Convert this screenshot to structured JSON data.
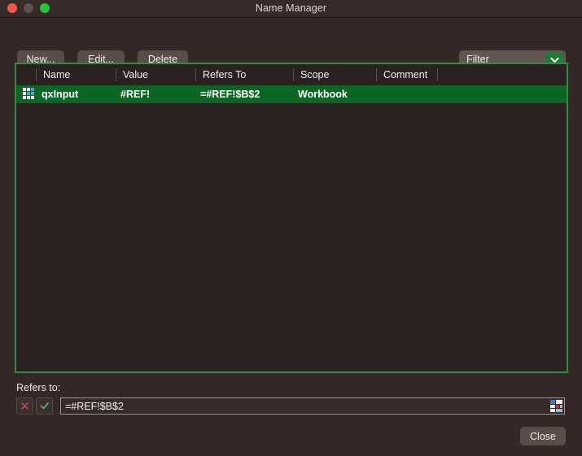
{
  "window": {
    "title": "Name Manager",
    "traffic_lights": [
      "close-button",
      "minimize-button",
      "zoom-button"
    ]
  },
  "toolbar": {
    "new_label": "New...",
    "edit_label": "Edit...",
    "delete_label": "Delete",
    "filter_label": "Filter",
    "filter_icon": "chevron-down-icon"
  },
  "table": {
    "columns": [
      "Name",
      "Value",
      "Refers To",
      "Scope",
      "Comment"
    ],
    "rows": [
      {
        "icon": "spreadsheet-grid-icon",
        "name": "qxInput",
        "value": "#REF!",
        "refers_to": "=#REF!$B$2",
        "scope": "Workbook",
        "comment": "",
        "selected": true
      }
    ]
  },
  "refers_to": {
    "label": "Refers to:",
    "cancel_icon": "x-icon",
    "accept_icon": "check-icon",
    "value": "=#REF!$B$2",
    "placeholder": "",
    "range_picker_icon": "range-select-icon"
  },
  "footer": {
    "close_label": "Close"
  },
  "colors": {
    "window_bg": "#332826",
    "titlebar_bg": "#362b29",
    "table_bg": "#2b2120",
    "selection_green": "#0b6623",
    "border_green": "#2f8b3d",
    "button_bg": "#5a4d49",
    "accent_green": "#1d7a34"
  }
}
